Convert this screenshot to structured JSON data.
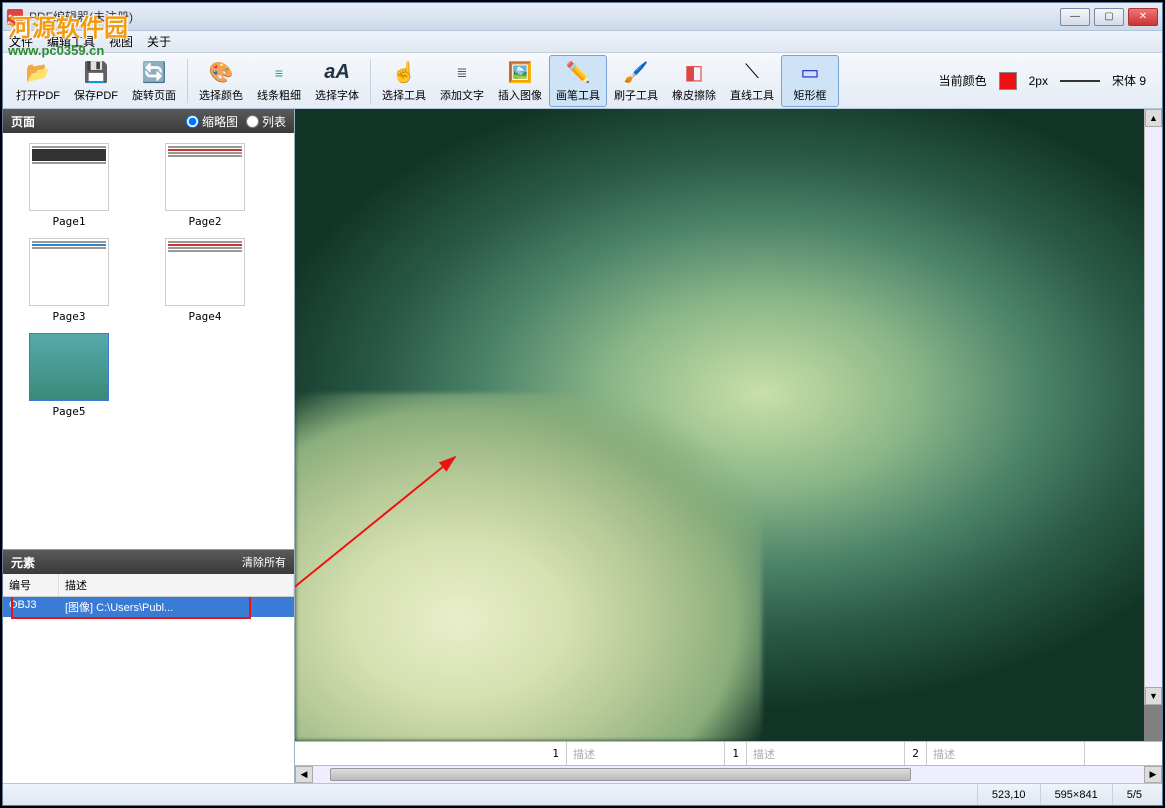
{
  "window": {
    "title": "PDF编辑器(未注册)"
  },
  "watermark": {
    "name": "河源软件园",
    "url": "www.pc0359.cn"
  },
  "menu": {
    "file": "文件",
    "edit_tools": "编辑工具",
    "view": "视图",
    "about": "关于"
  },
  "toolbar": {
    "open_pdf": "打开PDF",
    "save_pdf": "保存PDF",
    "rotate_page": "旋转页面",
    "select_color": "选择颜色",
    "line_weight": "线条粗细",
    "select_font": "选择字体",
    "select_tool": "选择工具",
    "add_text": "添加文字",
    "insert_image": "插入图像",
    "brush_tool": "画笔工具",
    "paint_tool": "刷子工具",
    "eraser_tool": "橡皮擦除",
    "line_tool": "直线工具",
    "rect_tool": "矩形框"
  },
  "toolbar_right": {
    "current_color_label": "当前颜色",
    "color": "#ee1111",
    "stroke_label": "2px",
    "font_label": "宋体 9"
  },
  "pages_pane": {
    "title": "页面",
    "view_thumb": "缩略图",
    "view_list": "列表",
    "pages": [
      {
        "label": "Page1"
      },
      {
        "label": "Page2"
      },
      {
        "label": "Page3"
      },
      {
        "label": "Page4"
      },
      {
        "label": "Page5"
      }
    ]
  },
  "elements_pane": {
    "title": "元素",
    "clear_all": "清除所有",
    "col_id": "编号",
    "col_desc": "描述",
    "rows": [
      {
        "id": "OBJ3",
        "desc": "[图像] C:\\Users\\Publ..."
      }
    ]
  },
  "bottom_indices": {
    "desc_placeholder": "描述",
    "cells": [
      "1",
      "1",
      "2"
    ]
  },
  "statusbar": {
    "coords": "523,10",
    "dimensions": "595×841",
    "page_nav": "5/5"
  }
}
